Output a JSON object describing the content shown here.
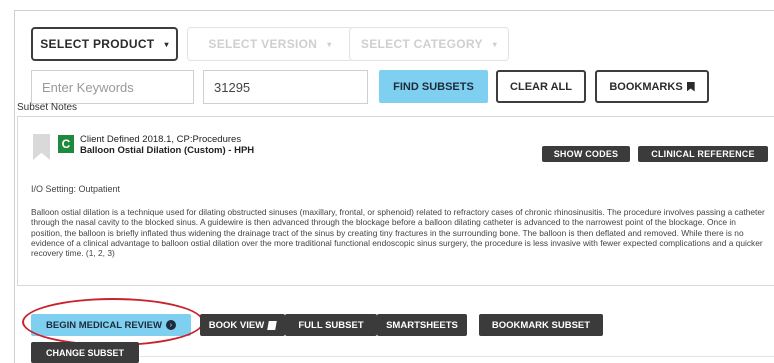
{
  "filters": {
    "product_label": "SELECT PRODUCT",
    "version_label": "SELECT VERSION",
    "category_label": "SELECT CATEGORY",
    "caret": "▾"
  },
  "search": {
    "keywords_placeholder": "Enter Keywords",
    "code_value": "31295",
    "find_label": "FIND SUBSETS",
    "clear_label": "CLEAR ALL",
    "bookmarks_label": "BOOKMARKS",
    "bookmarks_icon": "bookmark-icon"
  },
  "notes": {
    "label": "Subset Notes"
  },
  "subset": {
    "badge": "C",
    "title_line1": "Client Defined 2018.1, CP:Procedures",
    "title_line2": "Balloon Ostial Dilation (Custom) - HPH",
    "show_codes_label": "SHOW CODES",
    "clinical_reference_label": "CLINICAL REFERENCE",
    "setting": "I/O Setting: Outpatient",
    "description": "Balloon ostial dilation is a technique used for dilating obstructed sinuses (maxillary, frontal, or sphenoid) related to refractory cases of chronic rhinosinusitis. The procedure involves passing a catheter through the nasal cavity to the blocked sinus. A guidewire is then advanced through the blockage before a balloon dilating catheter is advanced to the narrowest point of the blockage. Once in position, the balloon is briefly inflated thus widening the drainage tract of the sinus by creating tiny fractures in the surrounding bone. The balloon is then deflated and removed. While there is no evidence of a clinical advantage to balloon ostial dilation over the more traditional functional endoscopic sinus surgery, the procedure is less invasive with fewer expected complications and a quicker recovery time. (1, 2, 3)"
  },
  "actions": {
    "begin_review_label": "BEGIN MEDICAL REVIEW",
    "begin_review_icon": "arrow-circle-icon",
    "book_view_label": "BOOK VIEW",
    "book_view_icon": "book-icon",
    "full_subset_label": "FULL SUBSET",
    "smartsheets_label": "SMARTSHEETS",
    "bookmark_subset_label": "BOOKMARK SUBSET",
    "change_subset_label": "CHANGE SUBSET"
  },
  "colors": {
    "accent": "#7fd0f0",
    "dark_button": "#3b3b3b",
    "badge_green": "#1f8a3e",
    "highlight_red": "#c8232c"
  }
}
